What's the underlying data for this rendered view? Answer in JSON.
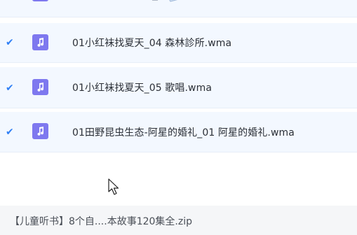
{
  "files": [
    {
      "name": "01小红袜找夏天_04 森林診所.wma",
      "checked": true,
      "icon": "music-note-icon"
    },
    {
      "name": "01小红袜找夏天_05 歌唱.wma",
      "checked": true,
      "icon": "music-note-icon"
    },
    {
      "name": "01田野昆虫生态-阿星的婚礼_01 阿星的婚礼.wma",
      "checked": true,
      "icon": "music-note-icon"
    }
  ],
  "footer": {
    "archive_name": "【儿童听书】8个自....本故事120集全.zip"
  },
  "colors": {
    "accent": "#2f7ff5",
    "file_icon": "#7e78ef",
    "row_bg": "#f3f8ff"
  }
}
